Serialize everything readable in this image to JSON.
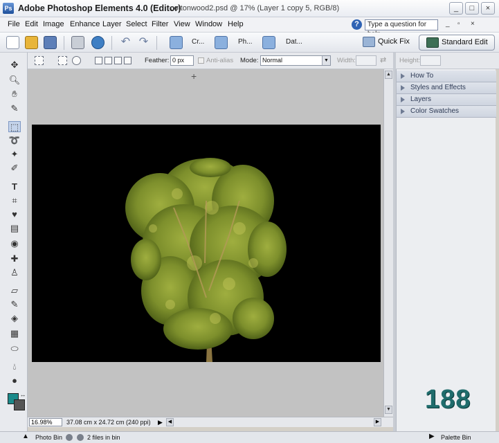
{
  "window": {
    "app_title": "Adobe Photoshop Elements 4.0 (Editor)",
    "doc_title": "cottonwood2.psd @ 17% (Layer 1 copy 5, RGB/8)",
    "minimize": "_",
    "maximize": "□",
    "close": "×"
  },
  "menubar": {
    "items": [
      "File",
      "Edit",
      "Image",
      "Enhance",
      "Layer",
      "Select",
      "Filter",
      "View",
      "Window",
      "Help"
    ],
    "help_placeholder": "Type a question for help"
  },
  "shortcuts": {
    "create_label": "Cr...",
    "photo_label": "Ph...",
    "date_label": "Dat...",
    "quick_fix": "Quick Fix",
    "standard_edit": "Standard Edit"
  },
  "options": {
    "feather_label": "Feather:",
    "feather_value": "0 px",
    "antialias_label": "Anti-alias",
    "mode_label": "Mode:",
    "mode_value": "Normal",
    "width_label": "Width:",
    "height_label": "Height:"
  },
  "palette_bin": {
    "items": [
      "How To",
      "Styles and Effects",
      "Layers",
      "Color Swatches"
    ]
  },
  "document": {
    "zoom": "16.98%",
    "info": "37.08 cm x 24.72 cm (240 ppi)"
  },
  "statusbar": {
    "photo_bin": "Photo Bin",
    "files_in_bin": "2 files in bin",
    "palette_bin": "Palette Bin"
  },
  "overlay_number": "188",
  "colors": {
    "foreground": "#1a8a8a",
    "background": "#555555"
  }
}
